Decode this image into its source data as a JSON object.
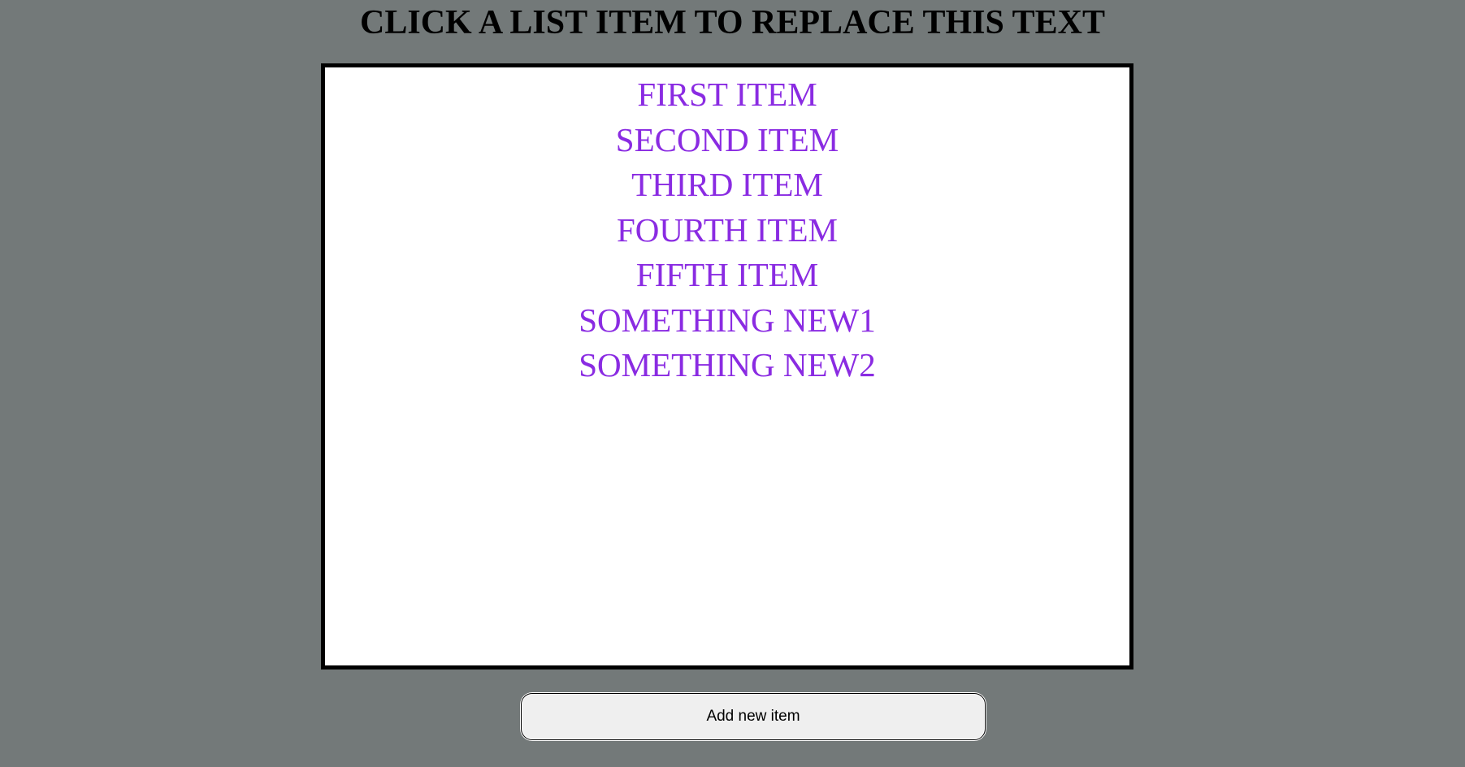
{
  "page": {
    "headline": "CLICK A LIST ITEM TO REPLACE THIS TEXT"
  },
  "list": {
    "items": [
      "FIRST ITEM",
      "SECOND ITEM",
      "THIRD ITEM",
      "FOURTH ITEM",
      "FIFTH ITEM",
      "SOMETHING NEW1",
      "SOMETHING NEW2"
    ]
  },
  "controls": {
    "add_button_label": "Add new item"
  },
  "colors": {
    "background": "#737979",
    "list_text": "#8a2be2",
    "list_background": "#ffffff",
    "border": "#000000"
  }
}
